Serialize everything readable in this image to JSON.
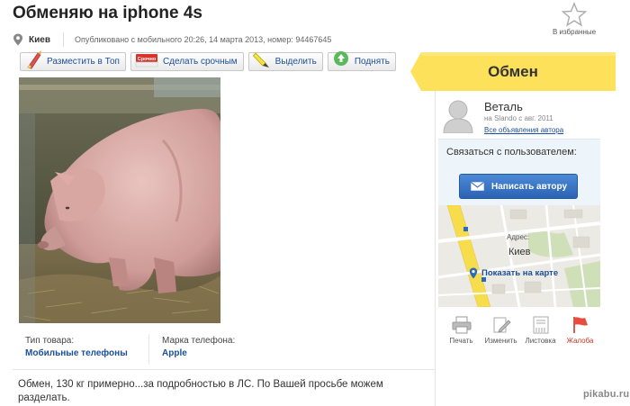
{
  "listing": {
    "title": "Обменяю на iphone 4s",
    "city": "Киев",
    "published": "Опубликовано с мобильного 20:26, 14 марта 2013, номер: 94467645",
    "favorites_label": "В избранные",
    "description": "Обмен, 130 кг примерно...за подробностью в ЛС. По Вашей просьбе можем разделать."
  },
  "toolbar": {
    "top_label": "Разместить в Топ",
    "urgent_label": "Сделать срочным",
    "urgent_badge": "Срочно",
    "highlight_label": "Выделить",
    "raise_label": "Поднять"
  },
  "attributes": [
    {
      "label": "Тип товара:",
      "value": "Мобильные телефоны"
    },
    {
      "label": "Марка телефона:",
      "value": "Apple"
    }
  ],
  "deal_type": "Обмен",
  "seller": {
    "name": "Веталь",
    "since": "на Slando с авг. 2011",
    "all_ads_link": "Все объявления автора"
  },
  "contact": {
    "label": "Связаться с пользователем:",
    "write_button": "Написать автору"
  },
  "map": {
    "address_label": "Адрес:",
    "city": "Киев",
    "show_link": "Показать на карте"
  },
  "actions": {
    "print": "Печать",
    "edit": "Изменить",
    "leaflet": "Листовка",
    "report": "Жалоба"
  },
  "watermark": "pikabu.ru",
  "colors": {
    "link": "#1a4f9c",
    "tag_yellow": "#fde15a",
    "button_blue": "#2b63b4",
    "report_red": "#c0392b"
  }
}
